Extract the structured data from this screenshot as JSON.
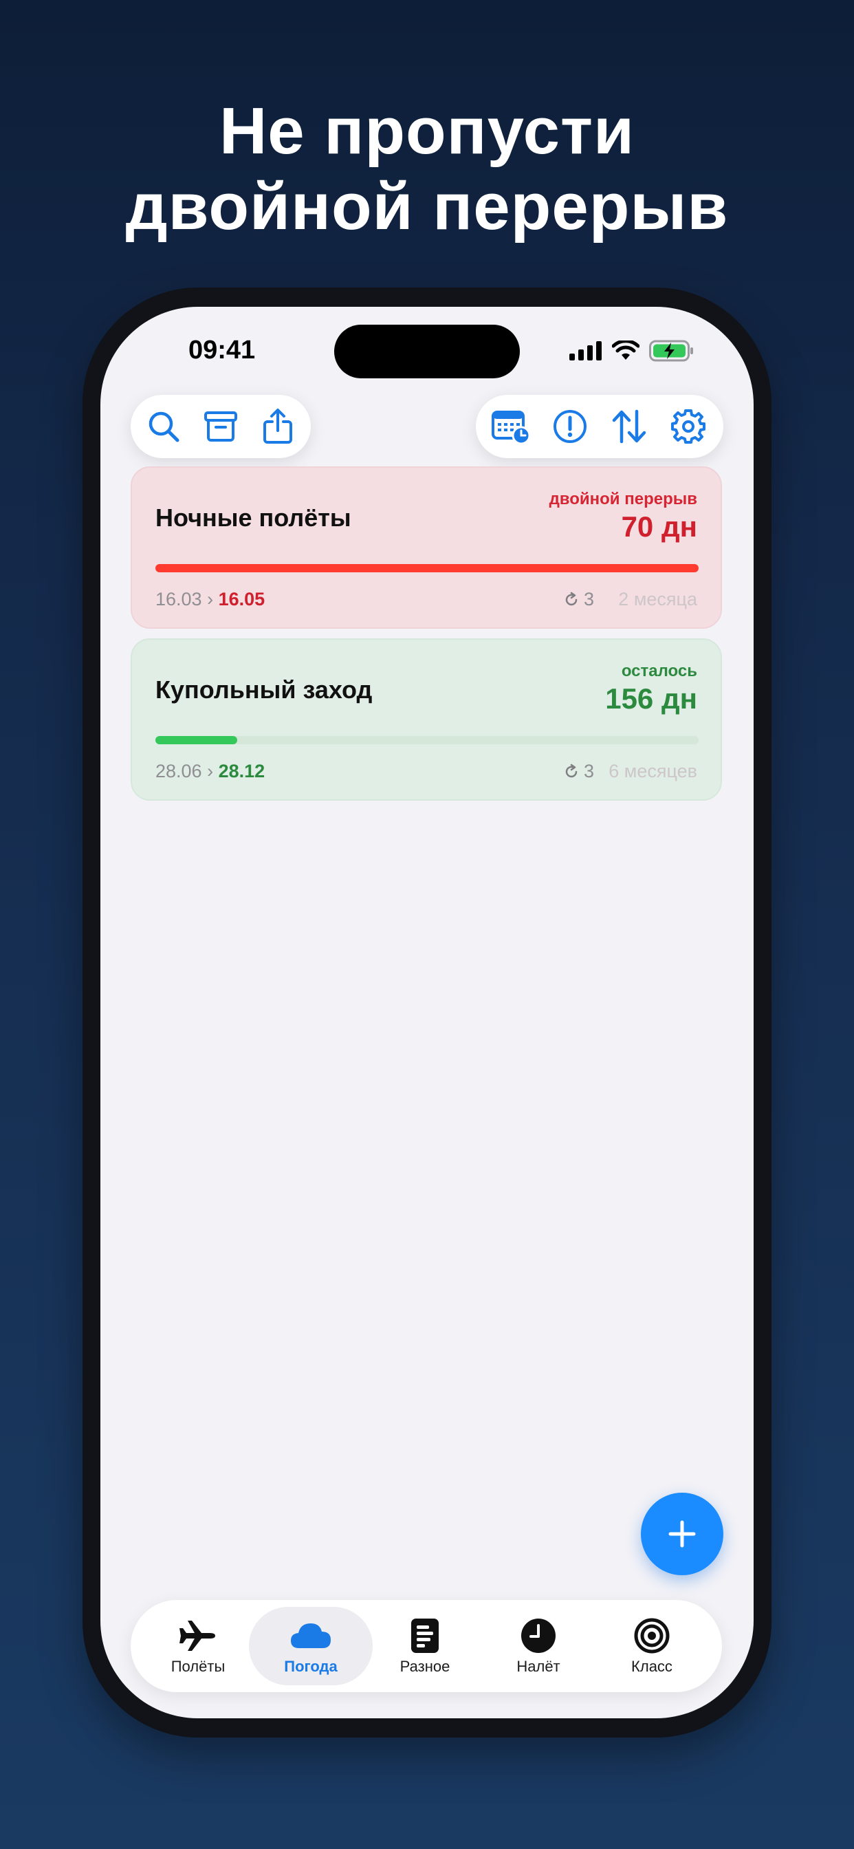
{
  "headline": {
    "line1": "Не пропусти",
    "line2": "двойной перерыв"
  },
  "status_bar": {
    "time": "09:41"
  },
  "toolbar": {
    "left_icons": [
      "search-icon",
      "archive-icon",
      "share-icon"
    ],
    "right_icons": [
      "calendar-clock-icon",
      "alert-icon",
      "sort-icon",
      "gear-icon"
    ],
    "accent_color": "#1a7ae6"
  },
  "cards": [
    {
      "title": "Ночные полёты",
      "status": "двойной перерыв",
      "days": "70 дн",
      "progress": 1.0,
      "date_from": "16.03",
      "date_to": "16.05",
      "repeat_count": "3",
      "period": "2 месяца",
      "color": "#e8343a"
    },
    {
      "title": "Купольный заход",
      "status": "осталось",
      "days": "156 дн",
      "progress": 0.15,
      "date_from": "28.06",
      "date_to": "28.12",
      "repeat_count": "3",
      "period": "6 месяцев",
      "color": "#2c8a3f"
    }
  ],
  "fab": {
    "icon": "plus-icon"
  },
  "tabs": [
    {
      "label": "Полёты",
      "icon": "airplane-icon",
      "active": false
    },
    {
      "label": "Погода",
      "icon": "cloud-icon",
      "active": true
    },
    {
      "label": "Разное",
      "icon": "document-icon",
      "active": false
    },
    {
      "label": "Налёт",
      "icon": "clock-icon",
      "active": false
    },
    {
      "label": "Класс",
      "icon": "target-icon",
      "active": false
    }
  ]
}
